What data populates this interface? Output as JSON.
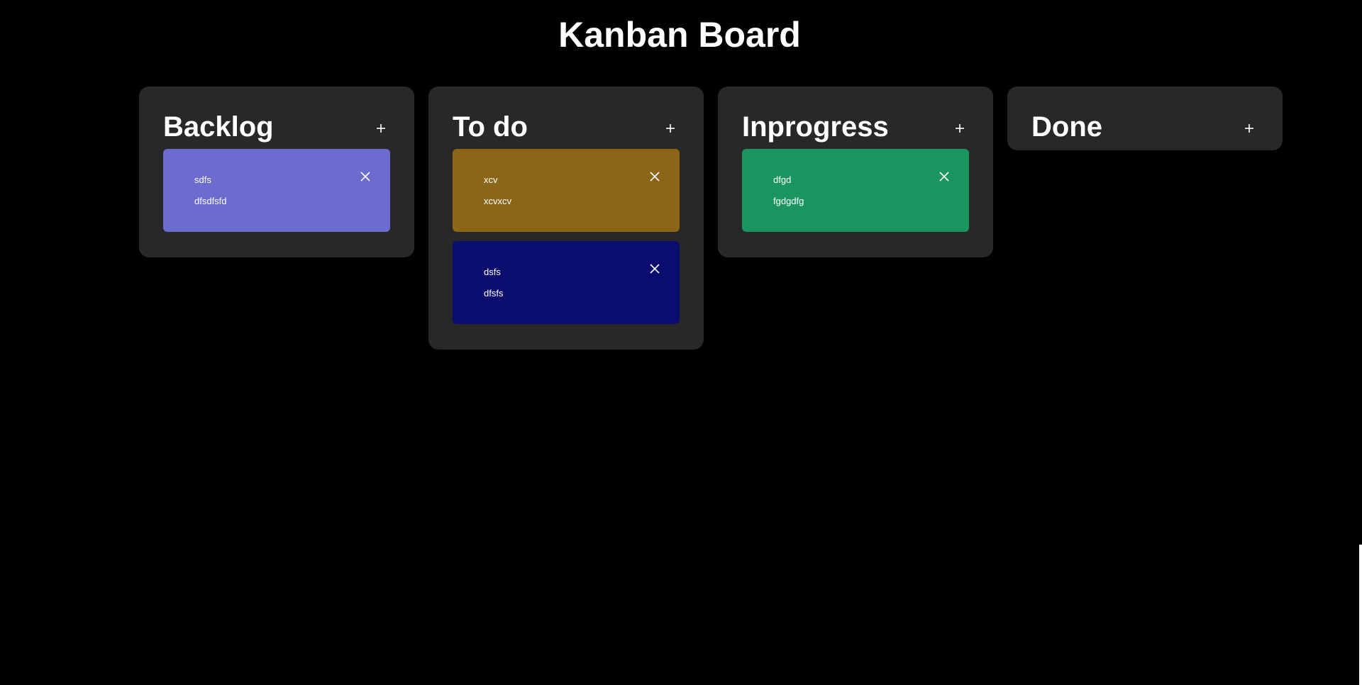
{
  "page": {
    "title": "Kanban Board"
  },
  "columns": [
    {
      "title": "Backlog",
      "add_icon": "plus-icon",
      "cards": [
        {
          "title": "sdfs",
          "description": "dfsdfsfd",
          "color": "#6c6ccf",
          "delete_icon": "close-icon"
        }
      ]
    },
    {
      "title": "To do",
      "add_icon": "plus-icon",
      "cards": [
        {
          "title": "xcv",
          "description": "xcvxcv",
          "color": "#8b6619",
          "delete_icon": "close-icon"
        },
        {
          "title": "dsfs",
          "description": "dfsfs",
          "color": "#0a0d6e",
          "delete_icon": "close-icon"
        }
      ]
    },
    {
      "title": "Inprogress",
      "add_icon": "plus-icon",
      "cards": [
        {
          "title": "dfgd",
          "description": "fgdgdfg",
          "color": "#1a955f",
          "delete_icon": "close-icon"
        }
      ]
    },
    {
      "title": "Done",
      "add_icon": "plus-icon",
      "cards": []
    }
  ],
  "colors": {
    "background": "#000000",
    "column_background": "#282828",
    "text": "#ffffff"
  }
}
